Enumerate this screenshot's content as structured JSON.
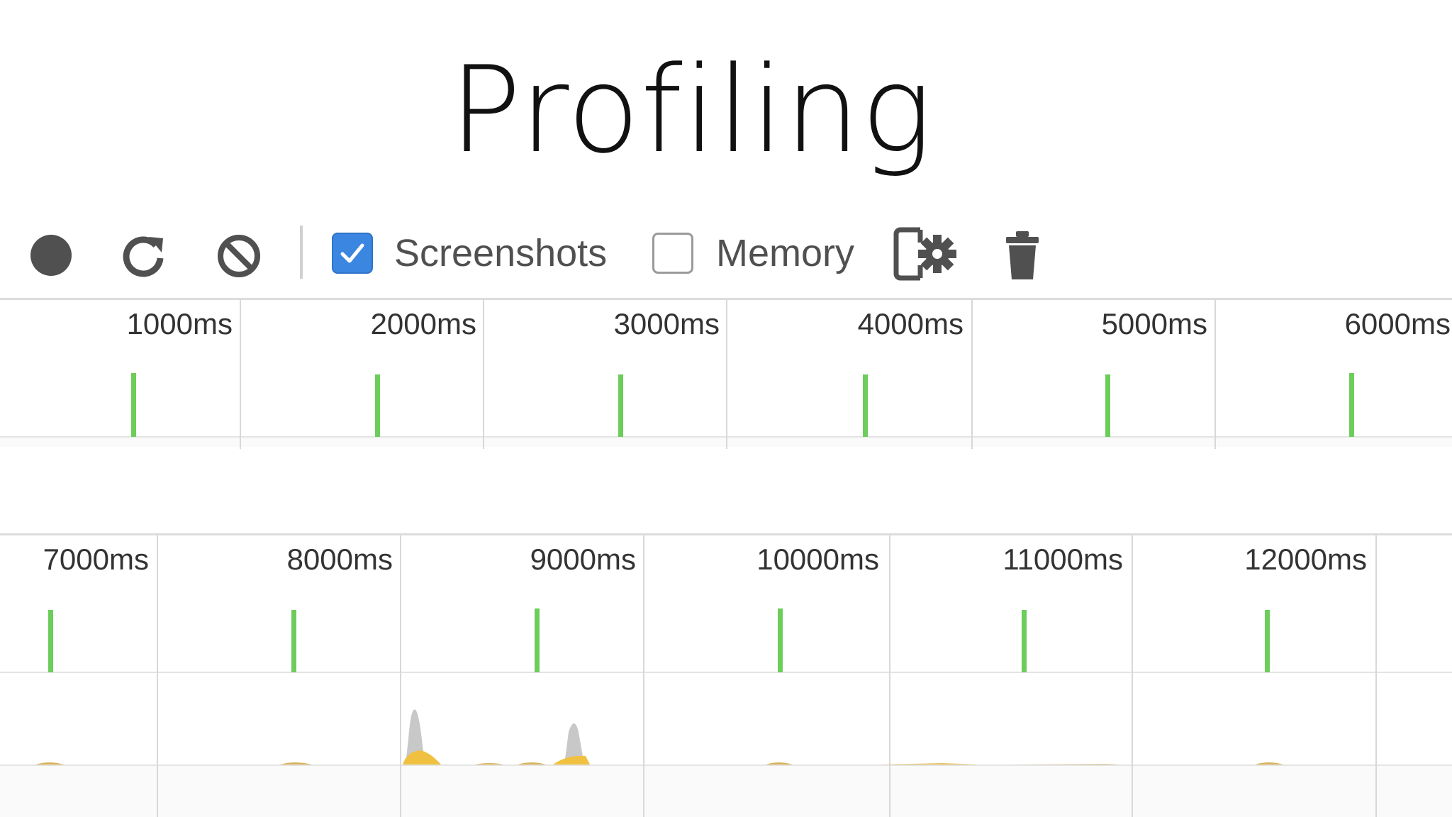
{
  "slide": {
    "title": "Profiling"
  },
  "toolbar": {
    "record": {
      "icon": "record-icon"
    },
    "reload": {
      "icon": "reload-icon"
    },
    "clear": {
      "icon": "clear-icon"
    },
    "screenshots": {
      "label": "Screenshots",
      "checked": true
    },
    "memory": {
      "label": "Memory",
      "checked": false
    },
    "settings": {
      "icon": "capture-settings-icon"
    },
    "garbage": {
      "icon": "trash-icon"
    }
  },
  "timeline": {
    "row1": {
      "ticks": [
        "1000ms",
        "2000ms",
        "3000ms",
        "4000ms",
        "5000ms",
        "6000ms"
      ]
    },
    "row2": {
      "ticks": [
        "7000ms",
        "8000ms",
        "9000ms",
        "10000ms",
        "11000ms",
        "12000ms"
      ]
    }
  },
  "colors": {
    "accent": "#3b86e0",
    "frame": "#6ccd5b",
    "scripting": "#f0c040",
    "idle": "#c8c8c8"
  }
}
